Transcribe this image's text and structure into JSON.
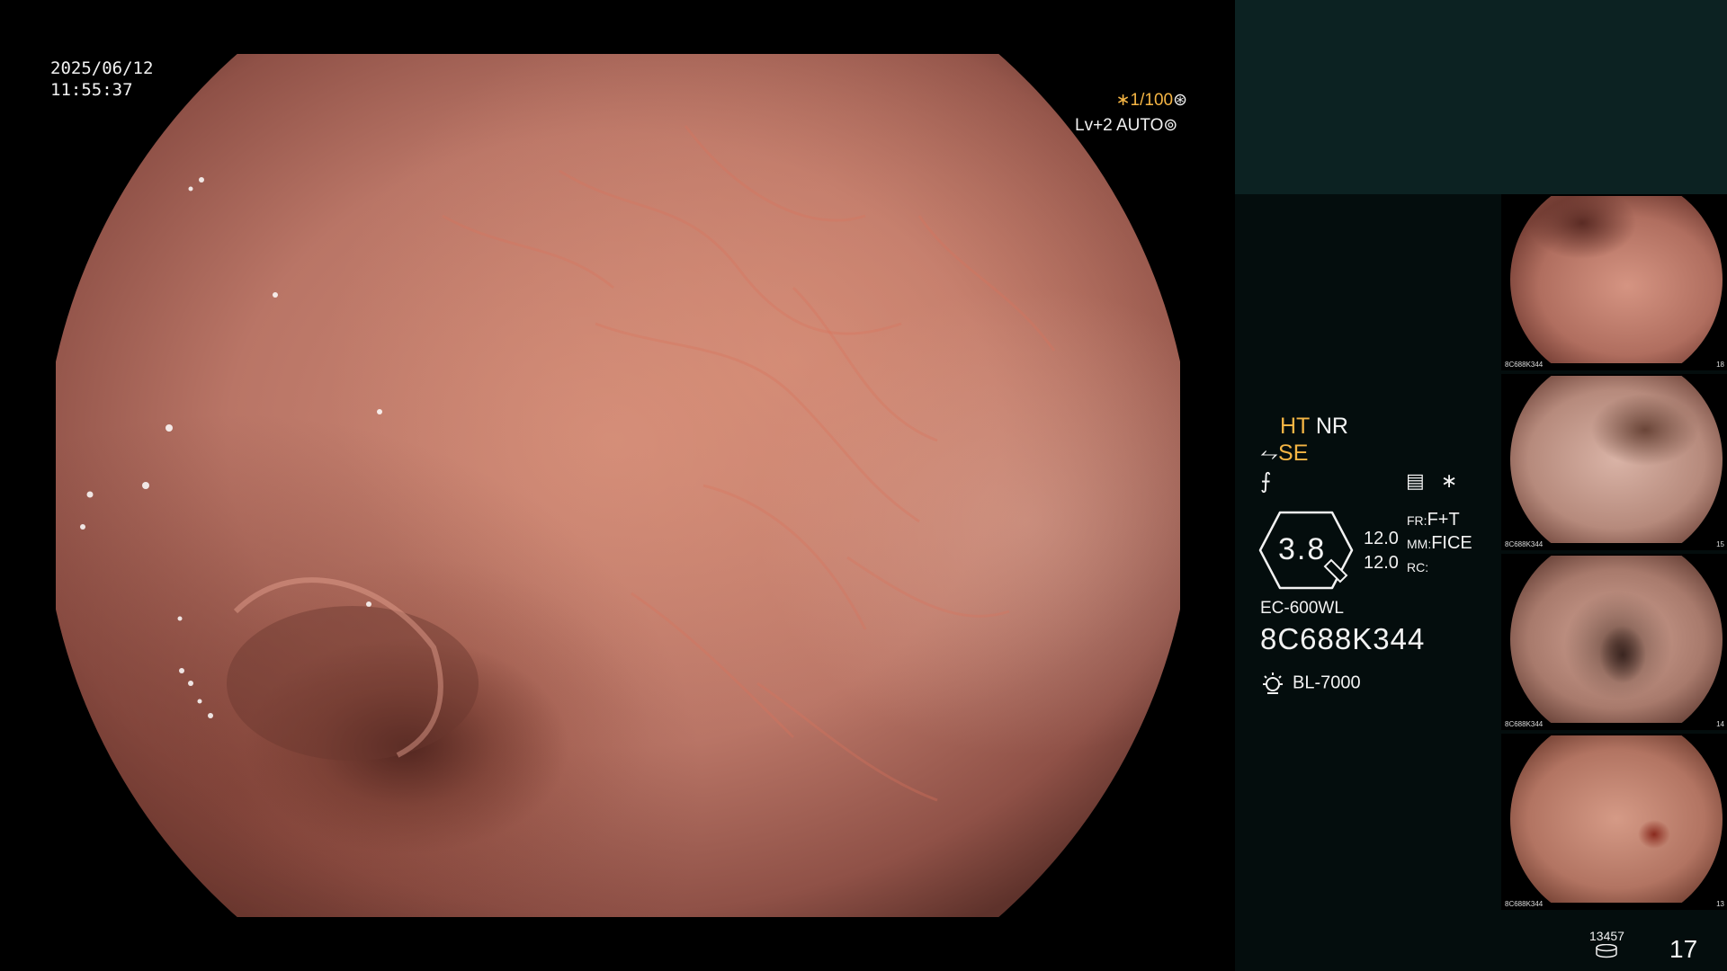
{
  "osd": {
    "date": "2025/06/12",
    "time": "11:55:37",
    "shutter": "∗1/100",
    "shutter_icon": "shutter-icon",
    "level": "Lv+2 AUTO",
    "level_icon": "iris-icon"
  },
  "panel": {
    "mode_ht": "HT",
    "mode_nr": "NR",
    "se_label": "SE",
    "f_label": "⨍",
    "asterisk": "∗",
    "zoom": "3.8",
    "value_1": "12.0",
    "value_2": "12.0",
    "fr_label": "FR:",
    "fr_value": "F+T",
    "mm_label": "MM:",
    "mm_value": "FICE",
    "rc_label": "RC:",
    "scope_model": "EC-600WL",
    "scope_serial": "8C688K344",
    "light_source": "BL-7000",
    "frame_count_small": "13457",
    "frame_count": "17"
  },
  "thumbnails": [
    {
      "caption": "8C688K344",
      "side": "18"
    },
    {
      "caption": "8C688K344",
      "side": "15"
    },
    {
      "caption": "8C688K344",
      "side": "14"
    },
    {
      "caption": "8C688K344",
      "side": "13"
    }
  ],
  "colors": {
    "accent_orange": "#f5b544",
    "panel_top": "#0c2222",
    "panel_bg": "#040d0d",
    "mucosa": "#c98371"
  }
}
